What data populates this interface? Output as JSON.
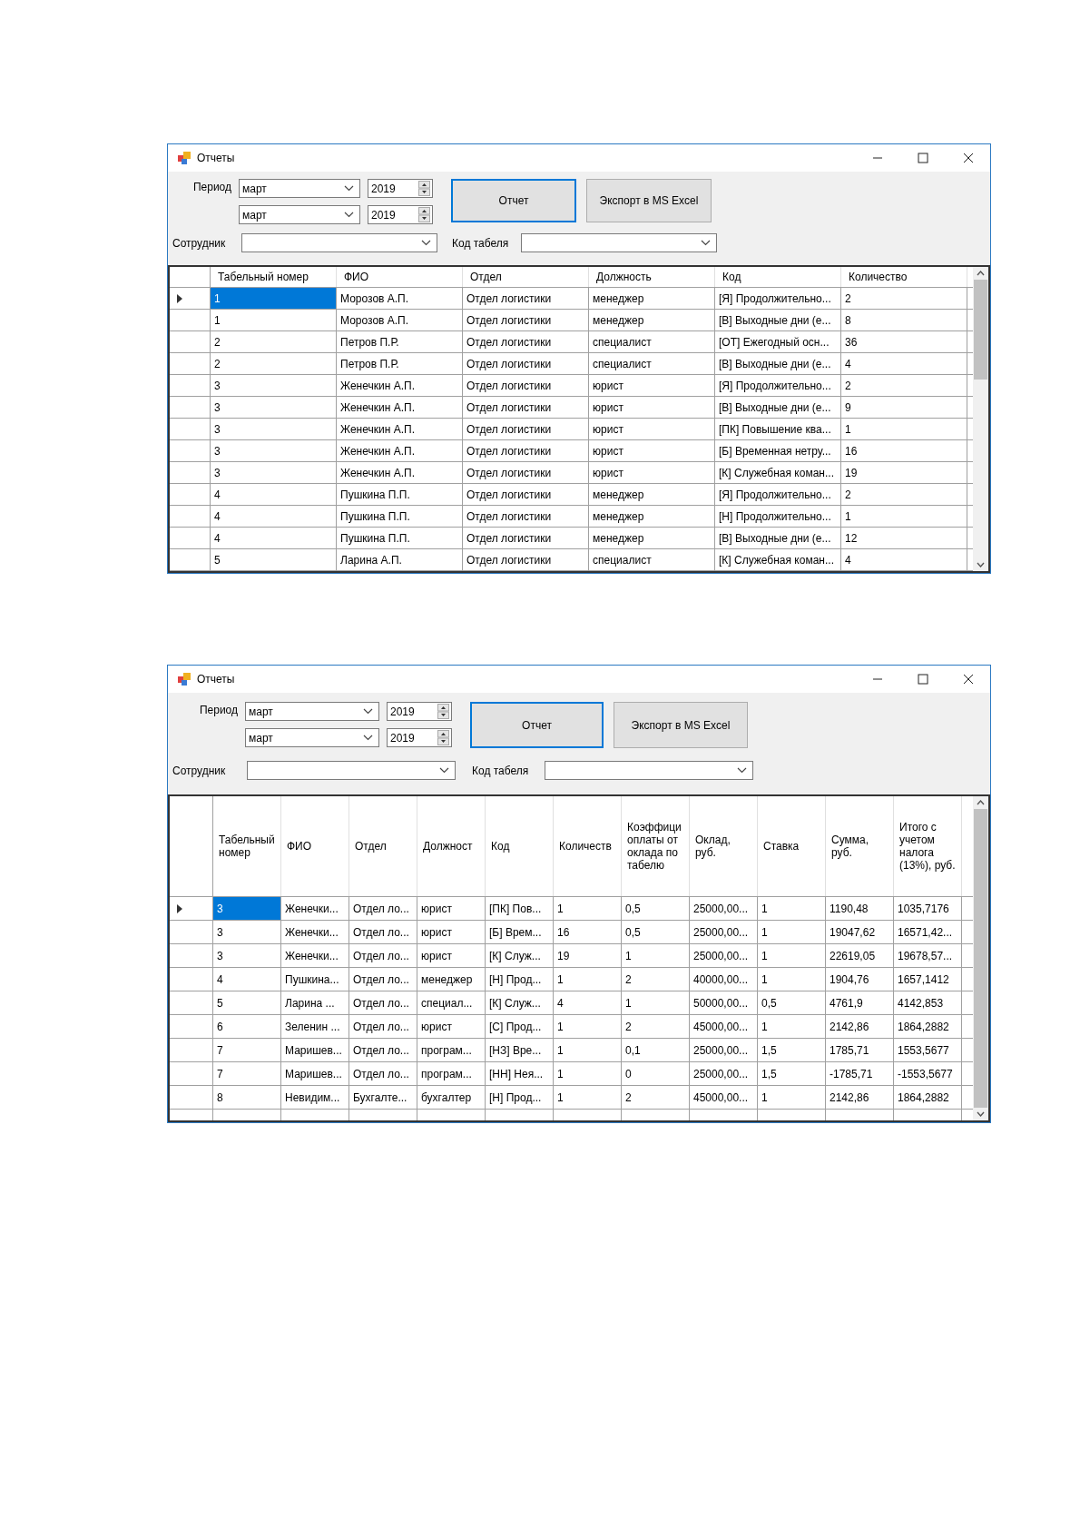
{
  "windows": [
    {
      "title": "Отчеты",
      "period_label": "Период",
      "months": [
        "март",
        "март"
      ],
      "years": [
        "2019",
        "2019"
      ],
      "report_button": "Отчет",
      "export_button": "Экспорт в MS Excel",
      "employee_label": "Сотрудник",
      "code_label": "Код табеля",
      "grid": {
        "columns": [
          "Табельный номер",
          "ФИО",
          "Отдел",
          "Должность",
          "Код",
          "Количество"
        ],
        "blank_row_below": false,
        "rows": [
          {
            "selected": true,
            "cells": [
              "1",
              "Морозов А.П.",
              "Отдел логистики",
              "менеджер",
              "[Я] Продолжительно...",
              "2"
            ]
          },
          {
            "selected": false,
            "cells": [
              "1",
              "Морозов А.П.",
              "Отдел логистики",
              "менеджер",
              "[В] Выходные дни (е...",
              "8"
            ]
          },
          {
            "selected": false,
            "cells": [
              "2",
              "Петров П.Р.",
              "Отдел логистики",
              "специалист",
              "[ОТ] Ежегодный осн...",
              "36"
            ]
          },
          {
            "selected": false,
            "cells": [
              "2",
              "Петров П.Р.",
              "Отдел логистики",
              "специалист",
              "[В] Выходные дни (е...",
              "4"
            ]
          },
          {
            "selected": false,
            "cells": [
              "3",
              "Женечкин А.П.",
              "Отдел логистики",
              "юрист",
              "[Я] Продолжительно...",
              "2"
            ]
          },
          {
            "selected": false,
            "cells": [
              "3",
              "Женечкин А.П.",
              "Отдел логистики",
              "юрист",
              "[В] Выходные дни (е...",
              "9"
            ]
          },
          {
            "selected": false,
            "cells": [
              "3",
              "Женечкин А.П.",
              "Отдел логистики",
              "юрист",
              "[ПК] Повышение ква...",
              "1"
            ]
          },
          {
            "selected": false,
            "cells": [
              "3",
              "Женечкин А.П.",
              "Отдел логистики",
              "юрист",
              "[Б] Временная нетру...",
              "16"
            ]
          },
          {
            "selected": false,
            "cells": [
              "3",
              "Женечкин А.П.",
              "Отдел логистики",
              "юрист",
              "[К] Служебная коман...",
              "19"
            ]
          },
          {
            "selected": false,
            "cells": [
              "4",
              "Пушкина П.П.",
              "Отдел логистики",
              "менеджер",
              "[Я] Продолжительно...",
              "2"
            ]
          },
          {
            "selected": false,
            "cells": [
              "4",
              "Пушкина П.П.",
              "Отдел логистики",
              "менеджер",
              "[Н] Продолжительно...",
              "1"
            ]
          },
          {
            "selected": false,
            "cells": [
              "4",
              "Пушкина П.П.",
              "Отдел логистики",
              "менеджер",
              "[В] Выходные дни (е...",
              "12"
            ]
          },
          {
            "selected": false,
            "cells": [
              "5",
              "Ларина А.П.",
              "Отдел логистики",
              "специалист",
              "[К] Служебная коман...",
              "4"
            ]
          }
        ]
      }
    },
    {
      "title": "Отчеты",
      "period_label": "Период",
      "months": [
        "март",
        "март"
      ],
      "years": [
        "2019",
        "2019"
      ],
      "report_button": "Отчет",
      "export_button": "Экспорт в MS Excel",
      "employee_label": "Сотрудник",
      "code_label": "Код табеля",
      "grid": {
        "columns": [
          "Табельный номер",
          "ФИО",
          "Отдел",
          "Должност",
          "Код",
          "Количеств",
          "Коэффици оплаты от оклада по табелю",
          "Оклад, руб.",
          "Ставка",
          "Сумма, руб.",
          "Итого с учетом налога (13%), руб."
        ],
        "blank_row_below": true,
        "rows": [
          {
            "selected": true,
            "cells": [
              "3",
              "Женечки...",
              "Отдел ло...",
              "юрист",
              "[ПК] Пов...",
              "1",
              "0,5",
              "25000,00...",
              "1",
              "1190,48",
              "1035,7176"
            ]
          },
          {
            "selected": false,
            "cells": [
              "3",
              "Женечки...",
              "Отдел ло...",
              "юрист",
              "[Б] Врем...",
              "16",
              "0,5",
              "25000,00...",
              "1",
              "19047,62",
              "16571,42..."
            ]
          },
          {
            "selected": false,
            "cells": [
              "3",
              "Женечки...",
              "Отдел ло...",
              "юрист",
              "[К] Служ...",
              "19",
              "1",
              "25000,00...",
              "1",
              "22619,05",
              "19678,57..."
            ]
          },
          {
            "selected": false,
            "cells": [
              "4",
              "Пушкина...",
              "Отдел ло...",
              "менеджер",
              "[Н] Прод...",
              "1",
              "2",
              "40000,00...",
              "1",
              "1904,76",
              "1657,1412"
            ]
          },
          {
            "selected": false,
            "cells": [
              "5",
              "Ларина ...",
              "Отдел ло...",
              "специал...",
              "[К] Служ...",
              "4",
              "1",
              "50000,00...",
              "0,5",
              "4761,9",
              "4142,853"
            ]
          },
          {
            "selected": false,
            "cells": [
              "6",
              "Зеленин ...",
              "Отдел ло...",
              "юрист",
              "[С] Прод...",
              "1",
              "2",
              "45000,00...",
              "1",
              "2142,86",
              "1864,2882"
            ]
          },
          {
            "selected": false,
            "cells": [
              "7",
              "Маришев...",
              "Отдел ло...",
              "програм...",
              "[НЗ] Вре...",
              "1",
              "0,1",
              "25000,00...",
              "1,5",
              "1785,71",
              "1553,5677"
            ]
          },
          {
            "selected": false,
            "cells": [
              "7",
              "Маришев...",
              "Отдел ло...",
              "програм...",
              "[НН] Нея...",
              "1",
              "0",
              "25000,00...",
              "1,5",
              "-1785,71",
              "-1553,5677"
            ]
          },
          {
            "selected": false,
            "cells": [
              "8",
              "Невидим...",
              "Бухгалте...",
              "бухгалтер",
              "[Н] Прод...",
              "1",
              "2",
              "45000,00...",
              "1",
              "2142,86",
              "1864,2882"
            ]
          }
        ]
      }
    }
  ]
}
